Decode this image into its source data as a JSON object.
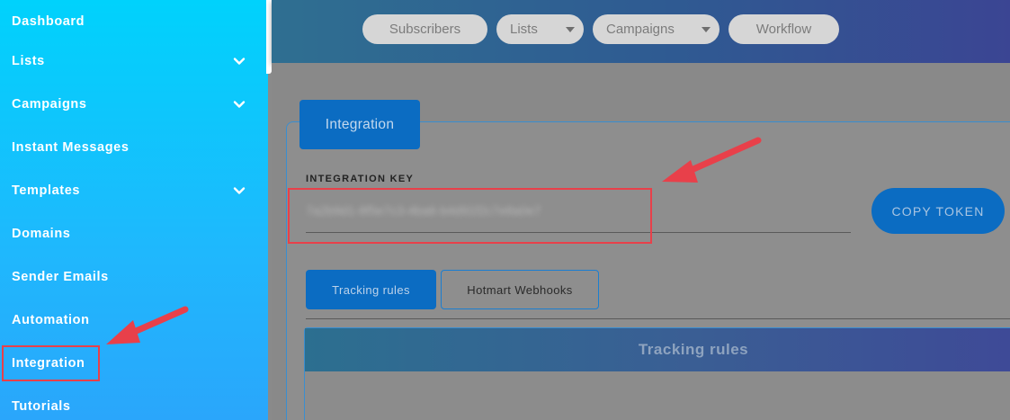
{
  "sidebar": {
    "items": [
      {
        "label": "Dashboard",
        "has_chevron": false
      },
      {
        "label": "Lists",
        "has_chevron": true
      },
      {
        "label": "Campaigns",
        "has_chevron": true
      },
      {
        "label": "Instant Messages",
        "has_chevron": false
      },
      {
        "label": "Templates",
        "has_chevron": true
      },
      {
        "label": "Domains",
        "has_chevron": false
      },
      {
        "label": "Sender Emails",
        "has_chevron": false
      },
      {
        "label": "Automation",
        "has_chevron": false
      },
      {
        "label": "Integration",
        "has_chevron": false,
        "highlighted": true
      },
      {
        "label": "Tutorials",
        "has_chevron": false
      }
    ]
  },
  "topnav": {
    "subscribers": "Subscribers",
    "lists": "Lists",
    "campaigns": "Campaigns",
    "workflow": "Workflow"
  },
  "integration": {
    "tab_label": "Integration",
    "key_label": "INTEGRATION KEY",
    "key_value": "7a2b9d1-8f5e7c3-4ba6-b4d91f2c7e8a0e7",
    "copy_button": "COPY TOKEN"
  },
  "tabs": {
    "tracking_rules": "Tracking rules",
    "hotmart_webhooks": "Hotmart Webhooks"
  },
  "panel": {
    "title": "Tracking rules"
  },
  "colors": {
    "sidebar_top": "#00d2fc",
    "primary_blue": "#0b6cc2",
    "annotation_red": "#e8404a"
  },
  "icons": {
    "chevron": "chevron-down-icon",
    "caret": "caret-down-icon",
    "arrow": "annotation-arrow-icon"
  }
}
